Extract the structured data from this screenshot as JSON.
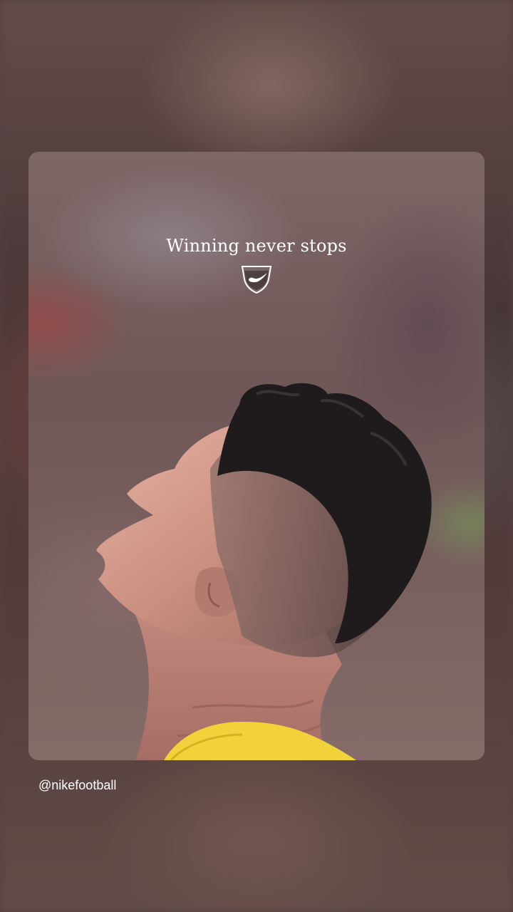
{
  "story": {
    "headline": "Winning never stops",
    "logo_icon": "nike-crest-icon",
    "handle": "@nikefootball"
  },
  "colors": {
    "jersey_yellow": "#f2d23a",
    "text": "#ffffff"
  }
}
